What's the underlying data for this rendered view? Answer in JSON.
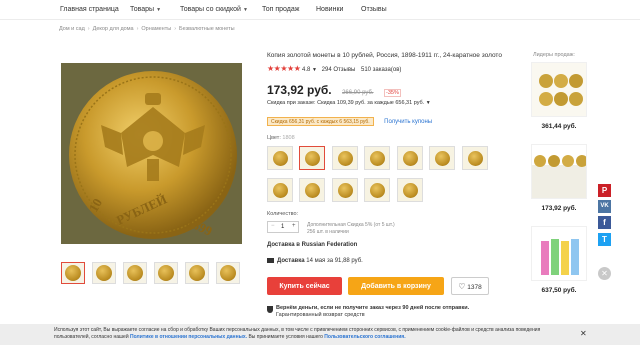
{
  "nav": {
    "items": [
      "Главная страница",
      "Товары",
      "Товары со скидкой",
      "Топ продаж",
      "Новинки",
      "Отзывы"
    ]
  },
  "breadcrumb": [
    "Дом и сад",
    "Декор для дома",
    "Орнаменты",
    "Безвалютные монеты"
  ],
  "product": {
    "title": "Копия золотой монеты в 10 рублей, Россия, 1898-1911 гг., 24-каратное золото",
    "rating": "4.8",
    "reviews": "294 Отзывы",
    "orders": "510 заказа(ов)",
    "price": "173,92 руб.",
    "old_price": "266,90 руб.",
    "discount": "-35%",
    "order_discount": "Скидка при заказе: Скидка 109,39 руб. за каждые 656,31 руб.",
    "coupon_badge": "Скидка 656,31 руб. с каждых 6 563,15 руб.",
    "coupon_link": "Получить купоны",
    "color_label": "Цвет:",
    "color_value": "1808",
    "qty_label": "Количество:",
    "qty_minus": "−",
    "qty_value": "1",
    "qty_plus": "+",
    "qty_note_1": "Дополнительная Скидка 5% (от 5 шт.)",
    "qty_note_2": "256 шт. в наличии",
    "delivery_prefix": "Доставка в",
    "delivery_country": "Russian Federation",
    "shipping_prefix": "Доставка",
    "shipping_detail": "14 мая за 91,88 руб.",
    "buy_now": "Купить сейчас",
    "add_to_cart": "Добавить в корзину",
    "wishlist_count": "1378",
    "guarantee_1": "Вернём деньги, если не получите заказ через 90 дней после отправки.",
    "guarantee_2": "Гарантированный возврат средств"
  },
  "leaders": {
    "title": "Лидеры продаж:",
    "prices": [
      "361,44 руб.",
      "173,92 руб.",
      "637,50 руб."
    ]
  },
  "social": [
    "P",
    "VK",
    "f",
    "T"
  ],
  "cookie": {
    "text_1": "Используя этот сайт, Вы выражаете согласие на сбор и обработку Ваших персональных данных, в том числе с привлечением сторонних сервисов, с применением cookie-файлов и средств анализа поведения пользователей, согласно нашей",
    "link_1": "Политике в отношении персональных данных.",
    "text_2": "Вы принимаете условия нашего",
    "link_2": "Пользовательского соглашения.",
    "close": "✕"
  },
  "colors": {
    "accent_red": "#e8403a",
    "accent_orange": "#f6a516",
    "link_blue": "#2b74d1",
    "pinterest": "#cb2027",
    "vk": "#4c75a3",
    "facebook": "#3b5998",
    "twitter": "#1da1f2"
  }
}
